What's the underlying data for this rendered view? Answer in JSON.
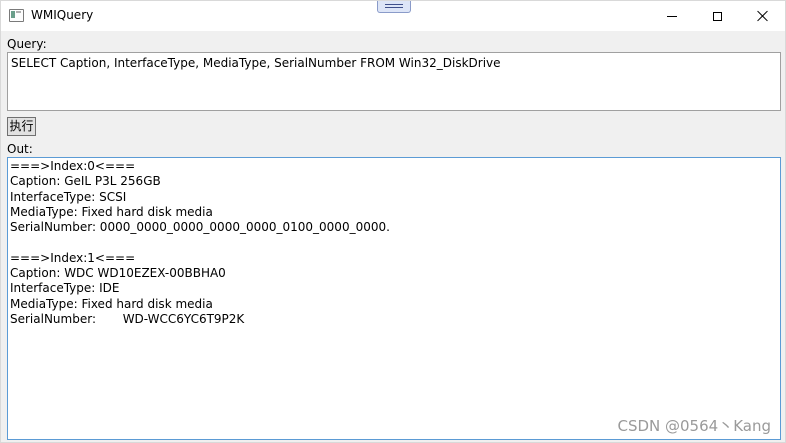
{
  "window": {
    "title": "WMIQuery"
  },
  "query": {
    "label": "Query:",
    "value": "SELECT Caption, InterfaceType, MediaType, SerialNumber FROM Win32_DiskDrive"
  },
  "execute_button": {
    "label": "执行"
  },
  "output": {
    "label": "Out:",
    "lines": [
      "===>Index:0<===",
      "Caption: GeIL P3L 256GB",
      "InterfaceType: SCSI",
      "MediaType: Fixed hard disk media",
      "SerialNumber: 0000_0000_0000_0000_0000_0100_0000_0000.",
      "",
      "===>Index:1<===",
      "Caption: WDC WD10EZEX-00BBHA0",
      "InterfaceType: IDE",
      "MediaType: Fixed hard disk media",
      "SerialNumber:       WD-WCC6YC6T9P2K"
    ]
  },
  "watermark": "CSDN @0564丶Kang",
  "icons": {
    "app": "app-window-icon",
    "minimize": "minimize-icon",
    "maximize": "maximize-icon",
    "close": "close-icon",
    "snap": "snap-layout-grip"
  }
}
